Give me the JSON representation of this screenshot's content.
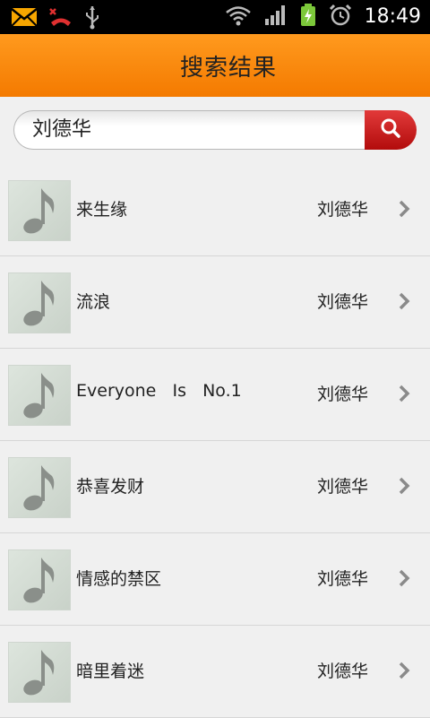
{
  "status_bar": {
    "time": "18:49"
  },
  "header": {
    "title": "搜索结果"
  },
  "search": {
    "value": "刘德华"
  },
  "results": [
    {
      "title": "来生缘",
      "artist": "刘德华"
    },
    {
      "title": "流浪",
      "artist": "刘德华"
    },
    {
      "title": "Everyone   Is   No.1",
      "artist": "刘德华"
    },
    {
      "title": "恭喜发财",
      "artist": "刘德华"
    },
    {
      "title": "情感的禁区",
      "artist": "刘德华"
    },
    {
      "title": "暗里着迷",
      "artist": "刘德华"
    }
  ],
  "colors": {
    "header_orange": "#f7870f",
    "search_red": "#c51a1a",
    "list_bg": "#f0f0f0"
  },
  "icons": {
    "status": [
      "mail-icon",
      "missed-call-icon",
      "usb-icon",
      "wifi-icon",
      "signal-icon",
      "battery-charging-icon",
      "alarm-icon"
    ],
    "row": [
      "music-note-icon",
      "chevron-right-icon"
    ],
    "search": "search-icon"
  }
}
